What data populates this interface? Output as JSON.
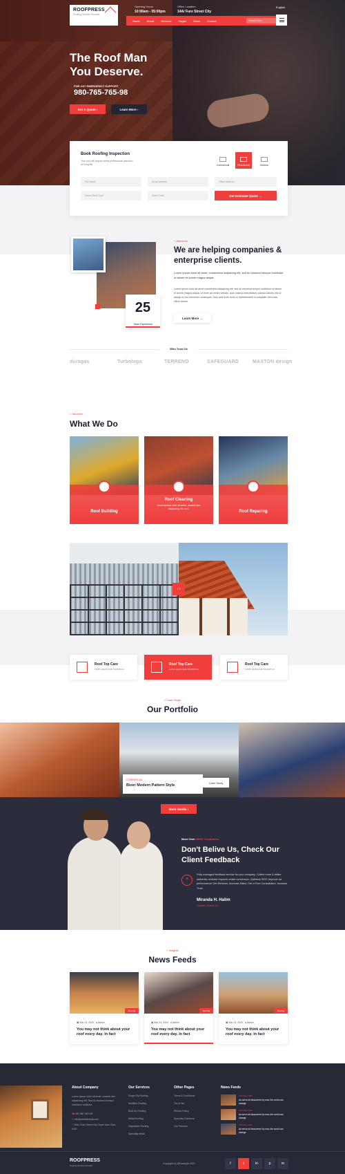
{
  "header": {
    "logo_title": "ROOFPRESS",
    "logo_sub": "Roofing Service Provider",
    "phone_label": "Opening Hours",
    "phone_value": "10:00am - 05:00pm",
    "office_label": "Office Location",
    "office_value": "14A/ Fure Street City",
    "language": "English",
    "nav": [
      "Home",
      "About",
      "Services",
      "Pages",
      "News",
      "Contact"
    ],
    "search_placeholder": "Search Here"
  },
  "hero": {
    "title_line1": "The Roof Man",
    "title_line2": "You Deserve.",
    "support_label": "FOR 24/7 EMERGENCY SUPPORT",
    "phone": "980-765-765-98",
    "btn_quote": "Get A Quote",
    "btn_learn": "Learn More"
  },
  "booking": {
    "title": "Book Roofing Inspection",
    "desc": "Your roof will require some professional attention for long life.",
    "types": [
      "Commercial",
      "Residential",
      "Outdoor"
    ],
    "fields": [
      "Full name",
      "Email address",
      "Office address",
      "Select Work Type",
      "Select Date"
    ],
    "submit": "Get Estimate Quote"
  },
  "about": {
    "tag": "About Us",
    "title": "We are helping companies & enterprise clients.",
    "lead": "Lorem ipsum dolor sit amet, consectetur adipiscing elit, sed do eiusmod tempor incididunt ut labore et dolore magna aliqua.",
    "body": "Lorem ipsum dolor sit amet,consectetur adipiscing elit, sed do eiusmod tempor incididunt ut labore et dolore magna aliqua. Ut enim ad minim veniam, quis nostrud exercitation ullamco laboris nisi ut aliquip ex ea commodo consequat. Duis aute irure dolor in reprehenderit in voluptate velit esse cillum dolore",
    "years": "25",
    "years_label": "Years Experience",
    "btn": "Learn More",
    "trust_label": "Who Trust Us",
    "brands": [
      "duragas",
      "Turbologo",
      "TERRENO",
      "SAFEGUARD",
      "MAXTON design"
    ]
  },
  "services": {
    "tag": "Services",
    "title": "What We Do",
    "cards": [
      {
        "name": "Roof Building"
      },
      {
        "name": "Roof Cleaning",
        "desc": "Lorem ipsum dolor sit amet, consect you adipiscing elit, sed."
      },
      {
        "name": "Roof Reparing"
      }
    ],
    "care": [
      {
        "title": "Roof Top Care",
        "desc": "Lorem ipsum dolor sit amet co"
      },
      {
        "title": "Roof Top Care",
        "desc": "Lorem ipsum dolor sit amet co"
      },
      {
        "title": "Roof Top Care",
        "desc": "Lorem ipsum dolor sit amet co"
      }
    ]
  },
  "portfolio": {
    "tag": "Case Study",
    "title": "Our Portfolio",
    "card_tag": "COMMERCIAL",
    "card_title": "Bixer Modern Pattern Style",
    "card_btn": "Case Study",
    "more_btn": "More Works"
  },
  "testimonial": {
    "stat_prefix": "More Over",
    "stat_value": "1800+ Customers",
    "title": "Don't Belive Us, Check Our Client Feedback",
    "quote": "Fully-managed feedback service for your company. Collect more & better authentic reviews! Improve onsite conversion, Optimize SEO, Improve ad performance! Get Reviews. Increase Sales. Get a Free Consultation. Increase Trust.",
    "name": "Miranda H. Halim",
    "role": "Founder, Roomb Co"
  },
  "news": {
    "tag": "Insights",
    "title": "News Feeds",
    "items": [
      {
        "date": "Mar 23, 2020",
        "author": "Admin",
        "title": "You may not think about your roof every day. In fact",
        "badge": "Roofing"
      },
      {
        "date": "Mar 23, 2020",
        "author": "Admin",
        "title": "You may not think about your roof every day. In fact",
        "badge": "Roofing"
      },
      {
        "date": "Mar 23, 2020",
        "author": "Admin",
        "title": "You may not think about your roof every day. In fact",
        "badge": "Roofing"
      }
    ]
  },
  "footer": {
    "about_title": "About Company",
    "about_text": "Lorem ipsum dolor sit amet, consect etur adipisicing elit. Sed do eiusmod tempor incididunt ut labore",
    "phone": "987-987-987-98",
    "email": "info@websitemail.com",
    "address": "14/A, Pure Street City Tower New York, USA",
    "services_title": "Our Services",
    "services": [
      "Single Ply Roofing",
      "Modified Roofing",
      "Built Up Roofing",
      "Metal Roofing",
      "Vegetative Roofing",
      "Specialty Metal"
    ],
    "pages_title": "Other Pages",
    "pages": [
      "Terms & Conditions",
      "Tax & Vat",
      "Refund Policy",
      "Specialty Solutions",
      "Our Process"
    ],
    "feeds_title": "News Feeds",
    "feeds": [
      {
        "date": "24th May 2020",
        "text": "As we've all discovered by now, the world can change."
      },
      {
        "date": "24th May 2020",
        "text": "As we've all discovered by now, the world can change."
      },
      {
        "date": "24th May 2020",
        "text": "As we've all discovered by now, the world can change."
      }
    ],
    "copyright": "Copyright by @Example 2020",
    "socials": [
      "f",
      "t",
      "in",
      "p",
      "m"
    ]
  }
}
